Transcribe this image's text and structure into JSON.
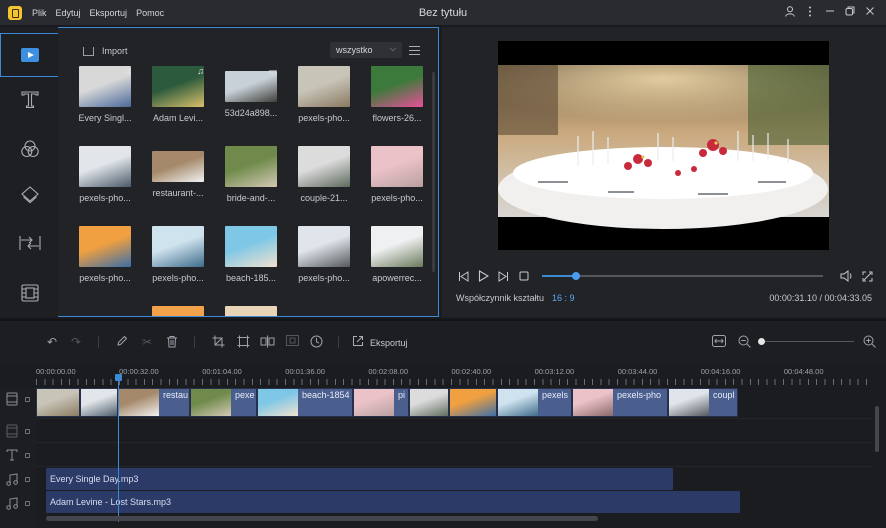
{
  "app": {
    "title": "Bez tytułu",
    "menu": [
      "Plik",
      "Edytuj",
      "Eksportuj",
      "Pomoc"
    ],
    "window_controls": [
      "user-icon",
      "more-icon",
      "minimize-icon",
      "restore-icon",
      "close-icon"
    ]
  },
  "sidebar": {
    "tools": [
      {
        "name": "media-tool",
        "icon": "play-icon",
        "active": true
      },
      {
        "name": "text-tool",
        "icon": "text-icon",
        "active": false
      },
      {
        "name": "filters-tool",
        "icon": "filters-icon",
        "active": false
      },
      {
        "name": "overlays-tool",
        "icon": "layers-icon",
        "active": false
      },
      {
        "name": "transitions-tool",
        "icon": "transition-icon",
        "active": false
      },
      {
        "name": "elements-tool",
        "icon": "film-icon",
        "active": false
      }
    ]
  },
  "media": {
    "import_label": "Import",
    "filter_value": "wszystko",
    "items": [
      {
        "label": "Every Singl...",
        "type": "audio",
        "colors": [
          "#d8d8d8",
          "#4b6a9a"
        ]
      },
      {
        "label": "Adam Levi...",
        "type": "audio",
        "colors": [
          "#2c5a3c",
          "#d9c16a"
        ]
      },
      {
        "label": "53d24a898...",
        "type": "video",
        "colors": [
          "#c8d0d8",
          "#3e3f3a"
        ]
      },
      {
        "label": "pexels-pho...",
        "type": "image",
        "colors": [
          "#c8c4b8",
          "#8a7a62"
        ]
      },
      {
        "label": "flowers-26...",
        "type": "image",
        "colors": [
          "#3b7a3a",
          "#e9509a"
        ]
      },
      {
        "label": "pexels-pho...",
        "type": "image",
        "colors": [
          "#e2e6ea",
          "#4a5a6a"
        ]
      },
      {
        "label": "restaurant-...",
        "type": "image",
        "colors": [
          "#a5896a",
          "#f2f2f2"
        ]
      },
      {
        "label": "bride-and-...",
        "type": "image",
        "colors": [
          "#6f8a4a",
          "#d4c9b4"
        ]
      },
      {
        "label": "couple-21...",
        "type": "image",
        "colors": [
          "#dcdcdc",
          "#5e6a5c"
        ]
      },
      {
        "label": "pexels-pho...",
        "type": "image",
        "colors": [
          "#eac2c8",
          "#b9a0a0"
        ]
      },
      {
        "label": "pexels-pho...",
        "type": "image",
        "colors": [
          "#f0a040",
          "#3a6ea8"
        ]
      },
      {
        "label": "pexels-pho...",
        "type": "image",
        "colors": [
          "#cfe3ef",
          "#3f6c8a"
        ]
      },
      {
        "label": "beach-185...",
        "type": "image",
        "colors": [
          "#7fc7e6",
          "#f1e2cf"
        ]
      },
      {
        "label": "pexels-pho...",
        "type": "image",
        "colors": [
          "#dfe5ea",
          "#55595e"
        ]
      },
      {
        "label": "apowerrec...",
        "type": "image",
        "colors": [
          "#eef0f1",
          "#6b7a5a"
        ]
      }
    ]
  },
  "preview": {
    "aspect_label": "Współczynnik kształtu",
    "aspect_value": "16 : 9",
    "current_time": "00:00:31.10",
    "total_time": "00:04:33.05",
    "timecode": "00:00:31.10 / 00:04:33.05",
    "progress_fraction": 0.12
  },
  "edit_toolbar": {
    "export_label": "Eksportuj",
    "tools": [
      "undo-icon",
      "redo-icon",
      "edit-icon",
      "cut-icon",
      "delete-icon",
      "crop-icon",
      "resize-icon",
      "split-icon",
      "mosaic-icon",
      "duration-icon"
    ],
    "zoom_fraction": 0.0
  },
  "timeline": {
    "ruler": [
      "00:00:00.00",
      "00:00:32.00",
      "00:01:04.00",
      "00:01:36.00",
      "00:02:08.00",
      "00:02:40.00",
      "00:03:12.00",
      "00:03:44.00",
      "00:04:16.00",
      "00:04:48.00"
    ],
    "video_clips": [
      {
        "label": "",
        "colors": [
          "#c8c4b8",
          "#8a7a62"
        ]
      },
      {
        "label": "",
        "colors": [
          "#e2e6ea",
          "#4a5a6a"
        ]
      },
      {
        "label": "restau",
        "colors": [
          "#a5896a",
          "#f2f2f2"
        ]
      },
      {
        "label": "pexe",
        "colors": [
          "#6f8a4a",
          "#d4c9b4"
        ]
      },
      {
        "label": "beach-1854",
        "colors": [
          "#7fc7e6",
          "#f1e2cf"
        ]
      },
      {
        "label": "pi",
        "colors": [
          "#eac2c8",
          "#b9a0a0"
        ]
      },
      {
        "label": "",
        "colors": [
          "#dcdcdc",
          "#5e6a5c"
        ]
      },
      {
        "label": "",
        "colors": [
          "#f0a040",
          "#3a6ea8"
        ]
      },
      {
        "label": "pexels",
        "colors": [
          "#cfe3ef",
          "#3f6c8a"
        ]
      },
      {
        "label": "pexels-pho",
        "colors": [
          "#eac2c8",
          "#8a6a6a"
        ]
      },
      {
        "label": "coupl",
        "colors": [
          "#dfe5ea",
          "#55595e"
        ]
      }
    ],
    "audio_tracks": [
      {
        "label": "Every Single Day.mp3"
      },
      {
        "label": "Adam Levine - Lost Stars.mp3"
      }
    ]
  },
  "colors": {
    "accent": "#3c8ad6",
    "audio_clip": "#2c3a68",
    "video_clip": "#4b5f8f"
  }
}
